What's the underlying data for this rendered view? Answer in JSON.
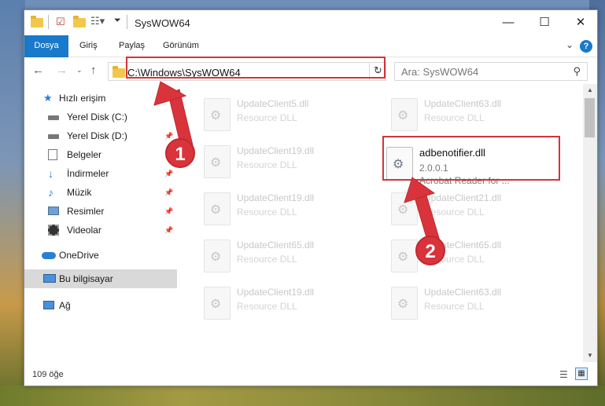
{
  "window": {
    "title": "SysWOW64"
  },
  "ribbon": {
    "tabs": [
      "Dosya",
      "Giriş",
      "Paylaş",
      "Görünüm"
    ],
    "help_label": "?",
    "minimize": "—",
    "maximize": "☐",
    "close": "✕"
  },
  "nav": {
    "address": "C:\\Windows\\SysWOW64",
    "search_placeholder": "Ara: SysWOW64"
  },
  "sidebar": {
    "items": [
      {
        "label": "Hızlı erişim",
        "icon": "star-icon",
        "pinned": false
      },
      {
        "label": "Yerel Disk (C:)",
        "icon": "drive-icon",
        "pinned": false
      },
      {
        "label": "Yerel Disk (D:)",
        "icon": "drive-icon",
        "pinned": true
      },
      {
        "label": "Belgeler",
        "icon": "documents-icon",
        "pinned": true
      },
      {
        "label": "İndirmeler",
        "icon": "download-icon",
        "pinned": true
      },
      {
        "label": "Müzik",
        "icon": "music-icon",
        "pinned": true
      },
      {
        "label": "Resimler",
        "icon": "pictures-icon",
        "pinned": true
      },
      {
        "label": "Videolar",
        "icon": "videos-icon",
        "pinned": true
      },
      {
        "label": "OneDrive",
        "icon": "cloud-icon",
        "pinned": false
      },
      {
        "label": "Bu bilgisayar",
        "icon": "computer-icon",
        "pinned": false,
        "selected": true
      },
      {
        "label": "Ağ",
        "icon": "network-icon",
        "pinned": false
      }
    ]
  },
  "files": {
    "left": [
      {
        "name": "UpdateClient5.dll",
        "desc": "Resource DLL"
      },
      {
        "name": "UpdateClient19.dll",
        "desc": "Resource DLL"
      },
      {
        "name": "UpdateClient19.dll",
        "desc": "Resource DLL"
      },
      {
        "name": "UpdateClient65.dll",
        "desc": "Resource DLL"
      },
      {
        "name": "UpdateClient19.dll",
        "desc": "Resource DLL"
      }
    ],
    "right": [
      {
        "name": "UpdateClient63.dll",
        "desc": "Resource DLL"
      },
      {
        "name": "adbenotifier.dll",
        "version": "2.0.0.1",
        "desc": "Acrobat Reader for ..."
      },
      {
        "name": "UpdateClient21.dll",
        "desc": "Resource DLL"
      },
      {
        "name": "UpdateClient65.dll",
        "desc": "Resource DLL"
      },
      {
        "name": "UpdateClient63.dll",
        "desc": "Resource DLL"
      }
    ]
  },
  "status": {
    "count": "109 öğe"
  },
  "annotations": {
    "badge1": "1",
    "badge2": "2",
    "color": "#d9343c"
  }
}
